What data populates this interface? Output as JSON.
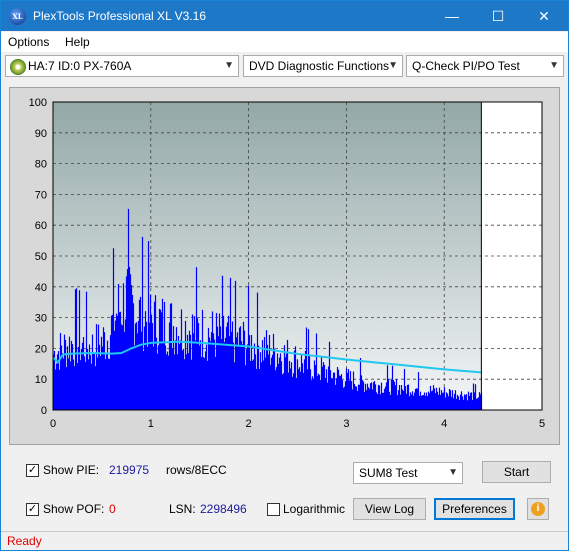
{
  "window": {
    "title": "PlexTools Professional XL V3.16",
    "icon_text": "XL",
    "minimize": "—",
    "maximize": "☐",
    "close": "✕"
  },
  "menu": {
    "options": "Options",
    "help": "Help"
  },
  "toolbar": {
    "drive": "HA:7 ID:0  PX-760A",
    "function": "DVD Diagnostic Functions",
    "test": "Q-Check PI/PO Test"
  },
  "controls": {
    "show_pie_label": "Show PIE:",
    "pie_value": "219975",
    "pie_unit": "rows/8ECC",
    "show_pof_label": "Show POF:",
    "pof_value": "0",
    "lsn_label": "LSN:",
    "lsn_value": "2298496",
    "logarithmic_label": "Logarithmic",
    "sum_select": "SUM8 Test",
    "start_button": "Start",
    "view_log_button": "View Log",
    "preferences_button": "Preferences",
    "show_pie_checked": true,
    "show_pof_checked": true,
    "logarithmic_checked": false
  },
  "status": {
    "text": "Ready"
  },
  "colors": {
    "titlebar": "#1e78c8",
    "bars": "#0000ff",
    "speed_line": "#1ec8f0",
    "status": "#e00000",
    "value_text": "#1a1a9e",
    "pof_value": "#e00000"
  },
  "chart_data": {
    "type": "bar",
    "x_range": [
      0,
      5
    ],
    "y_range": [
      0,
      100
    ],
    "x_ticks": [
      "0",
      "1",
      "2",
      "3",
      "4",
      "5"
    ],
    "y_ticks": [
      "0",
      "10",
      "20",
      "30",
      "40",
      "50",
      "60",
      "70",
      "80",
      "90",
      "100"
    ],
    "grid": true,
    "end_marker_x": 4.38,
    "pie_envelope": [
      {
        "x": 0.0,
        "y": 25
      },
      {
        "x": 0.2,
        "y": 30
      },
      {
        "x": 0.4,
        "y": 28
      },
      {
        "x": 0.55,
        "y": 32
      },
      {
        "x": 0.65,
        "y": 44
      },
      {
        "x": 0.75,
        "y": 50
      },
      {
        "x": 0.85,
        "y": 44
      },
      {
        "x": 1.0,
        "y": 40
      },
      {
        "x": 1.2,
        "y": 38
      },
      {
        "x": 1.4,
        "y": 36
      },
      {
        "x": 1.6,
        "y": 34
      },
      {
        "x": 1.8,
        "y": 32
      },
      {
        "x": 2.0,
        "y": 30
      },
      {
        "x": 2.2,
        "y": 27
      },
      {
        "x": 2.4,
        "y": 24
      },
      {
        "x": 2.6,
        "y": 20
      },
      {
        "x": 2.8,
        "y": 17
      },
      {
        "x": 3.0,
        "y": 14
      },
      {
        "x": 3.2,
        "y": 12
      },
      {
        "x": 3.4,
        "y": 11
      },
      {
        "x": 3.6,
        "y": 10
      },
      {
        "x": 3.8,
        "y": 9
      },
      {
        "x": 4.0,
        "y": 8
      },
      {
        "x": 4.2,
        "y": 7
      },
      {
        "x": 4.38,
        "y": 6
      }
    ],
    "speed_series": [
      {
        "x": 0.0,
        "y": 17
      },
      {
        "x": 0.05,
        "y": 15.5
      },
      {
        "x": 0.1,
        "y": 18
      },
      {
        "x": 0.2,
        "y": 18.3
      },
      {
        "x": 0.4,
        "y": 18.5
      },
      {
        "x": 0.6,
        "y": 18.3
      },
      {
        "x": 0.7,
        "y": 18.5
      },
      {
        "x": 0.8,
        "y": 20
      },
      {
        "x": 0.9,
        "y": 21.2
      },
      {
        "x": 1.0,
        "y": 21.8
      },
      {
        "x": 1.3,
        "y": 22.2
      },
      {
        "x": 1.6,
        "y": 21.6
      },
      {
        "x": 2.0,
        "y": 20.6
      },
      {
        "x": 2.5,
        "y": 18.2
      },
      {
        "x": 3.0,
        "y": 16.4
      },
      {
        "x": 3.5,
        "y": 14.8
      },
      {
        "x": 4.0,
        "y": 13.2
      },
      {
        "x": 4.38,
        "y": 12.2
      }
    ]
  }
}
